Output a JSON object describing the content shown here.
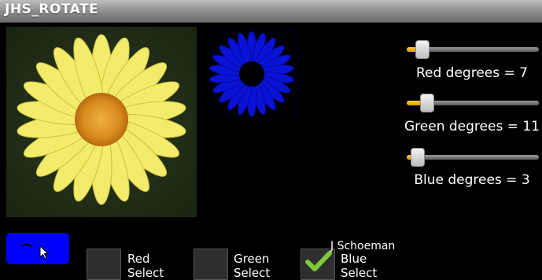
{
  "app": {
    "title": "JHS_ROTATE"
  },
  "sliders": [
    {
      "label": "Red degrees = 7",
      "level": 0.07
    },
    {
      "label": "Green degrees = 11",
      "level": 0.11
    },
    {
      "label": "Blue degrees = 3",
      "level": 0.03
    }
  ],
  "checkboxes": [
    {
      "label": "Red\nSelect",
      "checked": false
    },
    {
      "label": "Green\nSelect",
      "checked": false
    },
    {
      "label": "Blue\nSelect",
      "checked": true
    }
  ],
  "credit": "J Schoeman",
  "colors": {
    "button": "#0000ff",
    "flower_blue": "#0a12d8",
    "petal": "#f3ec6a",
    "center": "#e39b2a"
  }
}
